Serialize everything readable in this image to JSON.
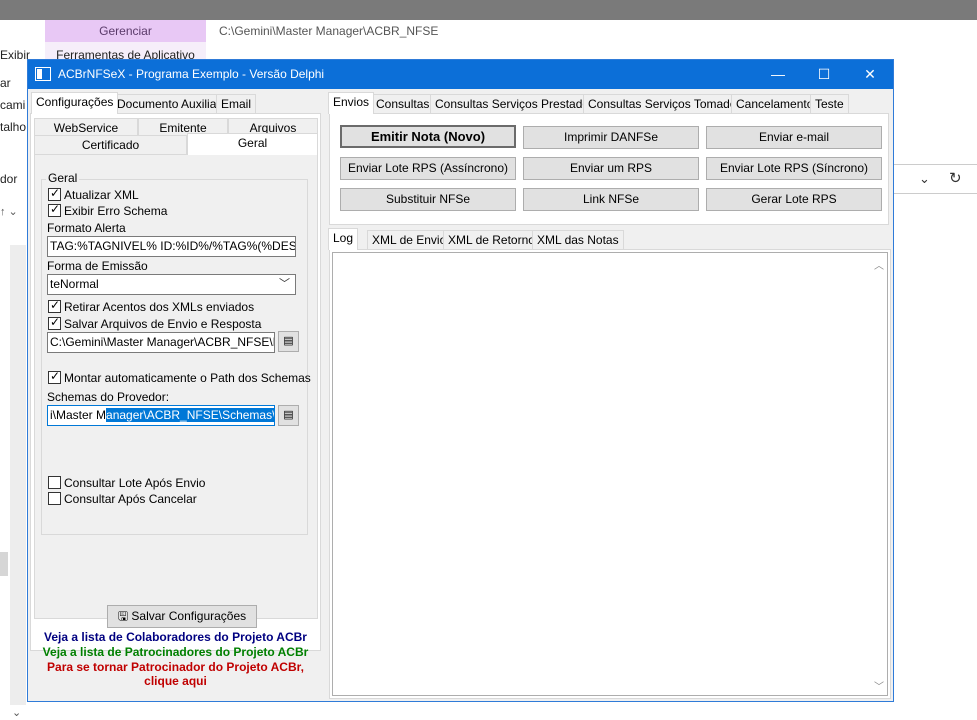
{
  "explorer": {
    "ribbon_manage": "Gerenciar",
    "ribbon_tools": "Ferramentas de Aplicativo",
    "path": "C:\\Gemini\\Master Manager\\ACBR_NFSE",
    "menu_exibir": "Exibir",
    "left_items": [
      "ar",
      "cami",
      "talho",
      "dor"
    ]
  },
  "window": {
    "title": "ACBrNFSeX - Programa Exemplo - Versão Delphi",
    "minimize": "—",
    "maximize": "☐",
    "close": "✕"
  },
  "left": {
    "tabs": [
      "Configurações",
      "Documento Auxiliar",
      "Email"
    ],
    "subtabs_row1": [
      "WebService",
      "Emitente",
      "Arquivos"
    ],
    "subtabs_row2": [
      "Certificado",
      "Geral"
    ],
    "group_title": "Geral",
    "chk_atualizar_xml": "Atualizar XML",
    "chk_exibir_erro": "Exibir Erro Schema",
    "formato_alerta_label": "Formato Alerta",
    "formato_alerta_value": "TAG:%TAGNIVEL% ID:%ID%/%TAG%(%DESCRI",
    "forma_emissao_label": "Forma de Emissão",
    "forma_emissao_value": "teNormal",
    "chk_retirar_acentos": "Retirar Acentos dos XMLs enviados",
    "chk_salvar_arquivos": "Salvar Arquivos de Envio e Resposta",
    "path_logs": "C:\\Gemini\\Master Manager\\ACBR_NFSE\\Logs",
    "chk_montar_path": "Montar automaticamente o Path dos Schemas",
    "schemas_label": "Schemas do Provedor:",
    "schemas_value_plain": "i\\Master M",
    "schemas_value_selected": "anager\\ACBR_NFSE\\Schemas\\NFSe",
    "chk_consultar_lote": "Consultar Lote Após Envio",
    "chk_consultar_cancelar": "Consultar Após Cancelar",
    "save_button": "Salvar Configurações",
    "link_colaboradores": "Veja a lista de Colaboradores do Projeto ACBr",
    "link_patrocinadores": "Veja a lista de Patrocinadores do Projeto ACBr",
    "link_patrocinador_1": "Para se tornar Patrocinador do Projeto ACBr,",
    "link_patrocinador_2": "clique aqui"
  },
  "right": {
    "tabs": [
      "Envios",
      "Consultas",
      "Consultas Serviços Prestados",
      "Consultas Serviços Tomados",
      "Cancelamento",
      "Teste"
    ],
    "buttons": [
      "Emitir Nota (Novo)",
      "Imprimir DANFSe",
      "Enviar e-mail",
      "Enviar Lote RPS (Assíncrono)",
      "Enviar um RPS",
      "Enviar Lote RPS (Síncrono)",
      "Substituir NFSe",
      "Link NFSe",
      "Gerar Lote RPS"
    ],
    "log_tabs": [
      "Log",
      "XML de Envio",
      "XML de Retorno",
      "XML das Notas"
    ]
  },
  "colors": {
    "titlebar": "#0c6fd8",
    "link_blue": "#000080",
    "link_green": "#008000",
    "link_red": "#800000"
  }
}
